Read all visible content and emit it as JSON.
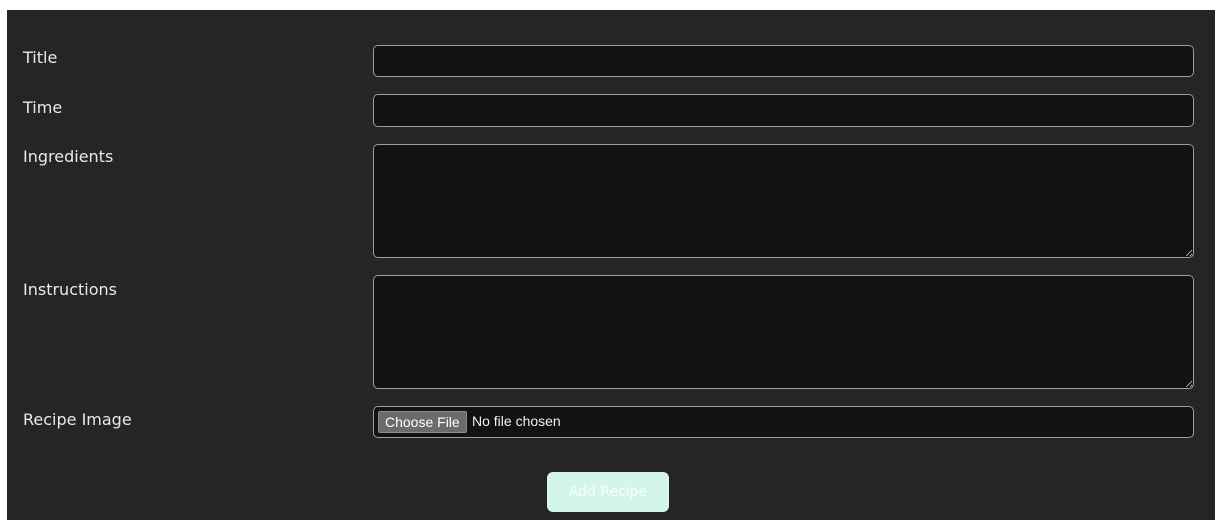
{
  "form": {
    "fields": [
      {
        "label": "Title",
        "value": "",
        "placeholder": ""
      },
      {
        "label": "Time",
        "value": "",
        "placeholder": ""
      },
      {
        "label": "Ingredients",
        "value": "",
        "placeholder": ""
      },
      {
        "label": "Instructions",
        "value": "",
        "placeholder": ""
      }
    ],
    "image": {
      "label": "Recipe Image",
      "button_label": "Choose File",
      "status": "No file chosen"
    },
    "submit_label": "Add Recipe"
  },
  "colors": {
    "panel_background": "#252525",
    "input_background": "#121212",
    "input_border": "#9c9c9c",
    "label_text": "#e9e9e9",
    "submit_button": "#d4f5eb"
  }
}
